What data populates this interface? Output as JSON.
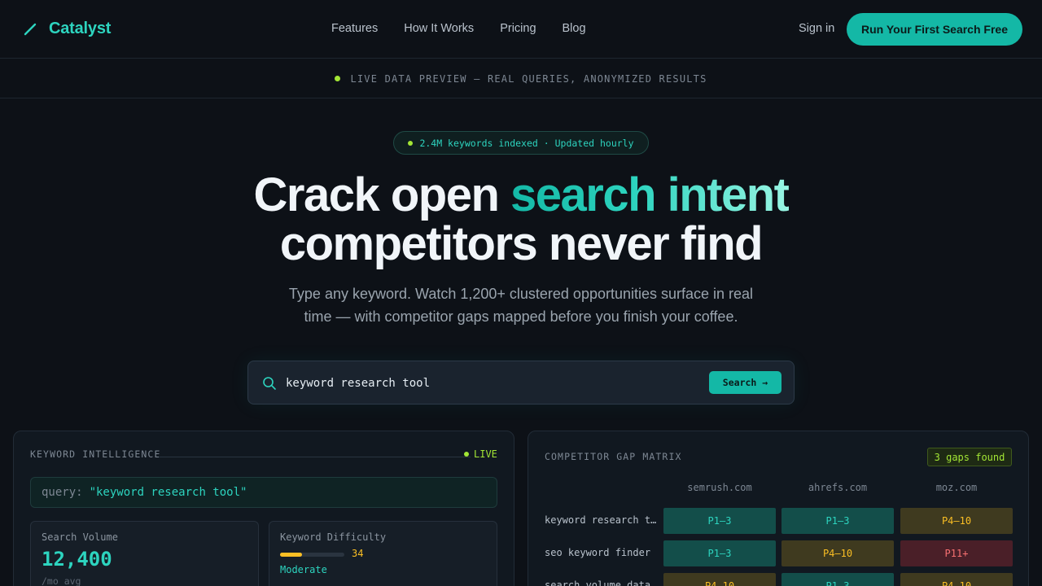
{
  "nav": {
    "brand": "Catalyst",
    "brand_icon": "wand-icon",
    "links": [
      "Features",
      "How It Works",
      "Pricing",
      "Blog"
    ],
    "sign_in": "Sign in",
    "cta": "Run Your First Search Free"
  },
  "strip": {
    "text": "LIVE DATA PREVIEW — REAL QUERIES, ANONYMIZED RESULTS"
  },
  "hero": {
    "badge": "2.4M keywords indexed · Updated hourly",
    "headline_part1": "Crack open ",
    "headline_accent": "search intent",
    "headline_part2": "competitors never find",
    "subtitle": "Type any keyword. Watch 1,200+ clustered opportunities surface in real time — with competitor gaps mapped before you finish your coffee."
  },
  "search": {
    "value": "keyword research tool",
    "button": "Search →"
  },
  "keyword_panel": {
    "title": "KEYWORD INTELLIGENCE",
    "live": "LIVE",
    "query_label": "query:",
    "query_value": "\"keyword research tool\"",
    "volume_label": "Search Volume",
    "volume_value": "12,400",
    "volume_unit": "/mo avg",
    "difficulty_label": "Keyword Difficulty",
    "difficulty_value": "34",
    "difficulty_fraction": 0.34,
    "difficulty_rating": "Moderate"
  },
  "gap_panel": {
    "title": "COMPETITOR GAP MATRIX",
    "badge": "3 gaps found",
    "competitors": [
      "semrush.com",
      "ahrefs.com",
      "moz.com"
    ],
    "rows": [
      {
        "keyword": "keyword research tool",
        "cells": [
          {
            "label": "P1–3",
            "status": "good"
          },
          {
            "label": "P1–3",
            "status": "good"
          },
          {
            "label": "P4–10",
            "status": "mid"
          }
        ]
      },
      {
        "keyword": "seo keyword finder",
        "cells": [
          {
            "label": "P1–3",
            "status": "good"
          },
          {
            "label": "P4–10",
            "status": "mid"
          },
          {
            "label": "P11+",
            "status": "bad"
          }
        ]
      },
      {
        "keyword": "search volume data",
        "cells": [
          {
            "label": "P4–10",
            "status": "mid"
          },
          {
            "label": "P1–3",
            "status": "good"
          },
          {
            "label": "P4–10",
            "status": "mid"
          }
        ]
      }
    ]
  },
  "colors": {
    "accent": "#14b8a6",
    "accent_light": "#2dd4bf",
    "live_green": "#a3e635",
    "warning": "#fbbf24",
    "danger": "#f87171",
    "background": "#0d1117"
  }
}
